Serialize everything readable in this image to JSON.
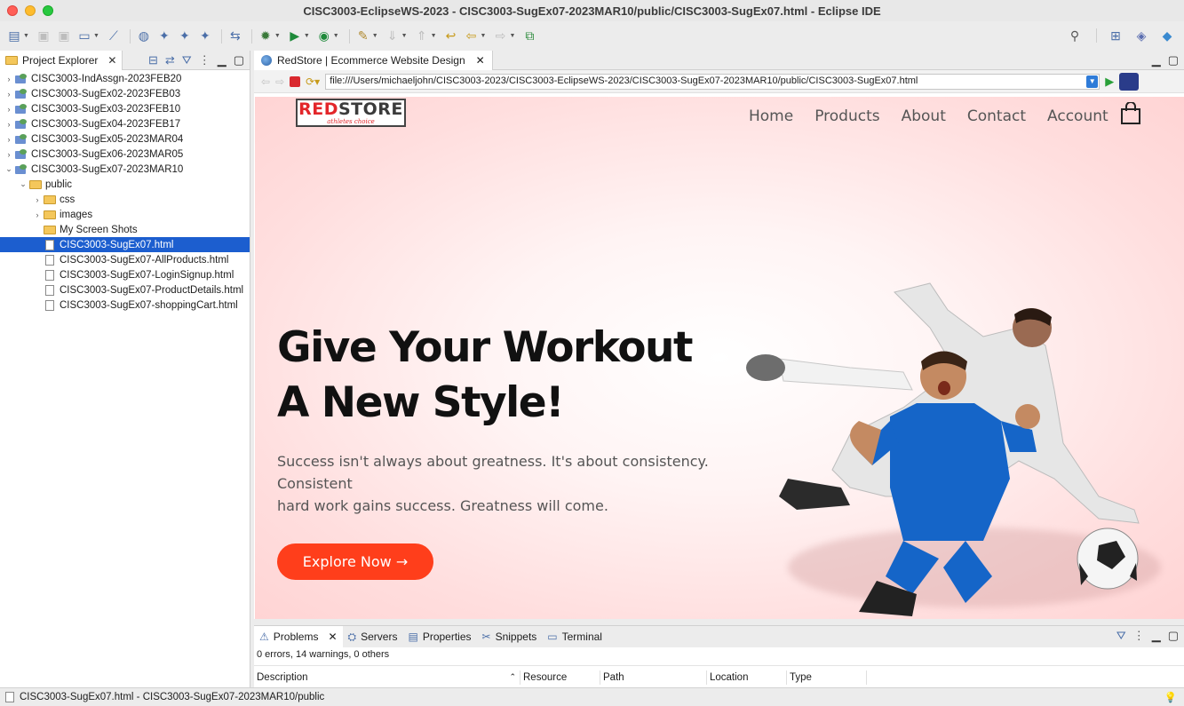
{
  "window": {
    "title": "CISC3003-EclipseWS-2023 - CISC3003-SugEx07-2023MAR10/public/CISC3003-SugEx07.html - Eclipse IDE"
  },
  "explorer": {
    "tab_label": "Project Explorer",
    "items": [
      {
        "label": "CISC3003-IndAssgn-2023FEB20",
        "level": 0,
        "type": "project",
        "expanded": false
      },
      {
        "label": "CISC3003-SugEx02-2023FEB03",
        "level": 0,
        "type": "project",
        "expanded": false
      },
      {
        "label": "CISC3003-SugEx03-2023FEB10",
        "level": 0,
        "type": "project",
        "expanded": false
      },
      {
        "label": "CISC3003-SugEx04-2023FEB17",
        "level": 0,
        "type": "project",
        "expanded": false
      },
      {
        "label": "CISC3003-SugEx05-2023MAR04",
        "level": 0,
        "type": "project",
        "expanded": false
      },
      {
        "label": "CISC3003-SugEx06-2023MAR05",
        "level": 0,
        "type": "project",
        "expanded": false
      },
      {
        "label": "CISC3003-SugEx07-2023MAR10",
        "level": 0,
        "type": "project",
        "expanded": true
      },
      {
        "label": "public",
        "level": 1,
        "type": "folder",
        "expanded": true
      },
      {
        "label": "css",
        "level": 2,
        "type": "folder",
        "expanded": false
      },
      {
        "label": "images",
        "level": 2,
        "type": "folder",
        "expanded": false
      },
      {
        "label": "My Screen Shots",
        "level": 2,
        "type": "folder",
        "expanded": null
      },
      {
        "label": "CISC3003-SugEx07.html",
        "level": 2,
        "type": "file",
        "selected": true
      },
      {
        "label": "CISC3003-SugEx07-AllProducts.html",
        "level": 2,
        "type": "file"
      },
      {
        "label": "CISC3003-SugEx07-LoginSignup.html",
        "level": 2,
        "type": "file"
      },
      {
        "label": "CISC3003-SugEx07-ProductDetails.html",
        "level": 2,
        "type": "file"
      },
      {
        "label": "CISC3003-SugEx07-shoppingCart.html",
        "level": 2,
        "type": "file"
      }
    ]
  },
  "editor": {
    "tab_label": "RedStore | Ecommerce Website Design",
    "url": "file:///Users/michaeljohn/CISC3003-2023/CISC3003-EclipseWS-2023/CISC3003-SugEx07-2023MAR10/public/CISC3003-SugEx07.html"
  },
  "site": {
    "logo_red": "RED",
    "logo_dark": "STORE",
    "logo_tagline": "athletes choice",
    "nav": [
      "Home",
      "Products",
      "About",
      "Contact",
      "Account"
    ],
    "hero_title_line1": "Give Your Workout",
    "hero_title_line2": "A New Style!",
    "hero_text_line1": "Success isn't always about greatness. It's about consistency.",
    "hero_text_line2": "Consistent",
    "hero_text_line3": "hard work gains success. Greatness will come.",
    "cta_label": "Explore Now →",
    "accent_color": "#ff523b"
  },
  "bottom_panel": {
    "tabs": [
      "Problems",
      "Servers",
      "Properties",
      "Snippets",
      "Terminal"
    ],
    "active_tab": "Problems",
    "summary": "0 errors, 14 warnings, 0 others",
    "columns": [
      "Description",
      "Resource",
      "Path",
      "Location",
      "Type"
    ]
  },
  "statusbar": {
    "text": "CISC3003-SugEx07.html - CISC3003-SugEx07-2023MAR10/public"
  }
}
